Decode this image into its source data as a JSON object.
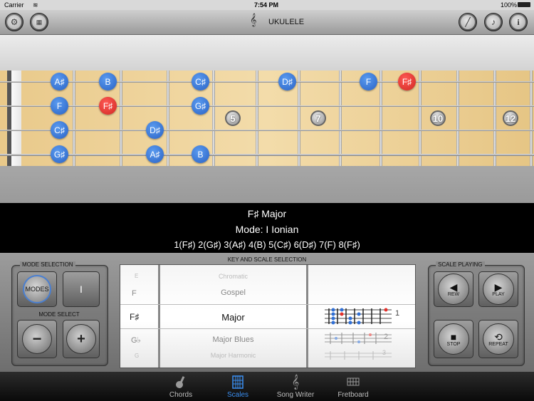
{
  "status_bar": {
    "carrier": "Carrier",
    "time": "7:54 PM",
    "battery": "100%"
  },
  "toolbar": {
    "title": "UKULELE",
    "left_icons": [
      "settings-gears-icon",
      "keyboard-icon"
    ],
    "right_icons": [
      "pick-icon",
      "music-note-icon",
      "info-icon"
    ],
    "info_glyph": "i",
    "note_glyph": "♪"
  },
  "fretboard": {
    "notes": [
      {
        "label": "A♯",
        "color": "blue"
      },
      {
        "label": "B",
        "color": "blue"
      },
      {
        "label": "C♯",
        "color": "blue"
      },
      {
        "label": "D♯",
        "color": "blue"
      },
      {
        "label": "F",
        "color": "blue"
      },
      {
        "label": "F♯",
        "color": "red"
      },
      {
        "label": "F",
        "color": "blue"
      },
      {
        "label": "F♯",
        "color": "red"
      },
      {
        "label": "G♯",
        "color": "blue"
      },
      {
        "label": "C♯",
        "color": "blue"
      },
      {
        "label": "D♯",
        "color": "blue"
      },
      {
        "label": "G♯",
        "color": "blue"
      },
      {
        "label": "A♯",
        "color": "blue"
      },
      {
        "label": "B",
        "color": "blue"
      }
    ],
    "fret_markers": [
      "5",
      "7",
      "10",
      "12"
    ],
    "note_colors": {
      "blue": "#2f6fd6",
      "red": "#e3302b"
    }
  },
  "scale_info": {
    "key_scale": "F♯ Major",
    "mode": "Mode: I Ionian",
    "degrees": [
      "1(F♯)",
      "2(G♯)",
      "3(A♯)",
      "4(B)",
      "5(C♯)",
      "6(D♯)",
      "7(F)",
      "8(F♯)"
    ]
  },
  "mode_selection": {
    "title": "MODE SELECTION",
    "modes_button": "MODES",
    "mode_value": "I",
    "mode_select_title": "MODE SELECT",
    "minus": "−",
    "plus": "+"
  },
  "key_scale_selection": {
    "title": "KEY AND SCALE SELECTION",
    "keys": [
      "E",
      "F",
      "F♯",
      "G♭",
      "G"
    ],
    "scales": [
      "Chromatic",
      "Gospel",
      "Major",
      "Major Blues",
      "Major Harmonic"
    ],
    "selected_key": "F♯",
    "selected_scale": "Major",
    "positions": [
      "1",
      "2",
      "3"
    ]
  },
  "scale_playing": {
    "title": "SCALE PLAYING",
    "buttons": [
      {
        "label": "REW",
        "icon": "rewind-icon",
        "glyph": "◀"
      },
      {
        "label": "PLAY",
        "icon": "play-icon",
        "glyph": "▶"
      },
      {
        "label": "STOP",
        "icon": "stop-icon",
        "glyph": "■"
      },
      {
        "label": "REPEAT",
        "icon": "repeat-icon",
        "glyph": "⟲"
      }
    ]
  },
  "tabbar": {
    "tabs": [
      {
        "label": "Chords",
        "icon": "guitar-icon",
        "active": false
      },
      {
        "label": "Scales",
        "icon": "scales-icon",
        "active": true
      },
      {
        "label": "Song Writer",
        "icon": "treble-clef-icon",
        "active": false
      },
      {
        "label": "Fretboard",
        "icon": "fretboard-icon",
        "active": false
      }
    ],
    "active_color": "#3a8ef0"
  }
}
